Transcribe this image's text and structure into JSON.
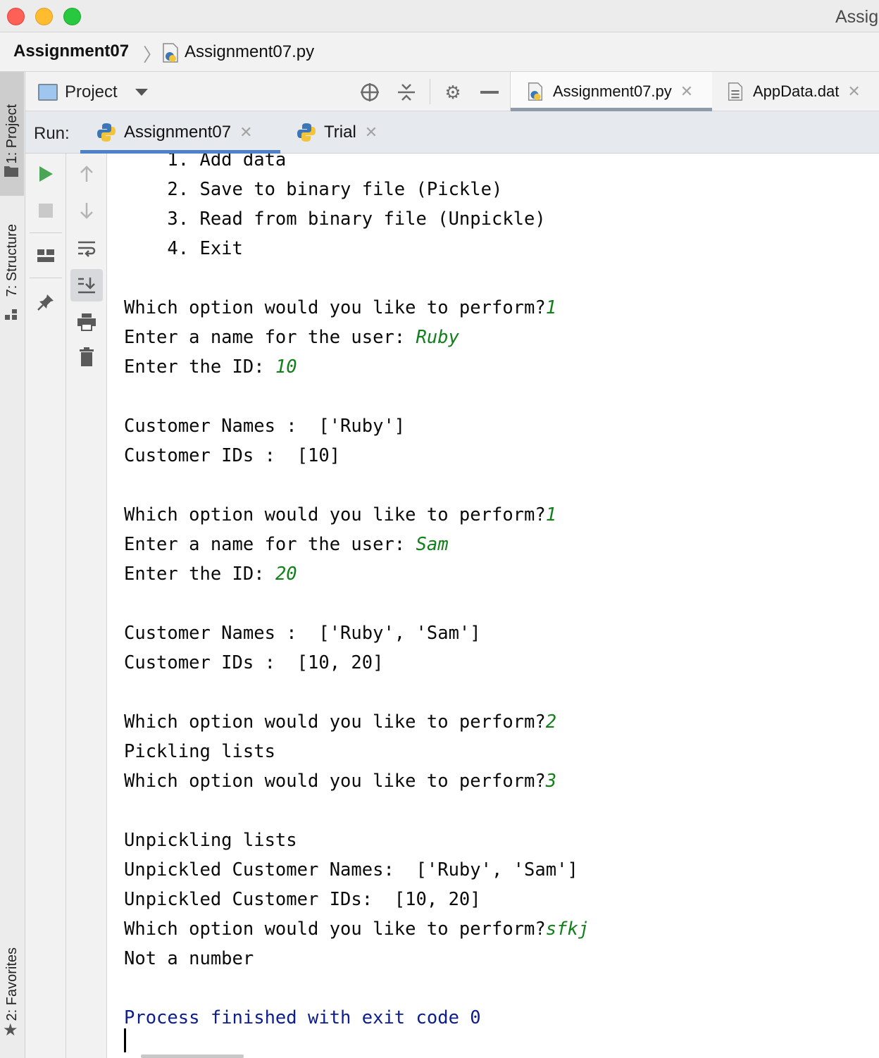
{
  "window": {
    "title": "Assig"
  },
  "breadcrumb": {
    "project": "Assignment07",
    "file": "Assignment07.py"
  },
  "sidebar": {
    "project_tab": "1: Project",
    "structure_tab": "7: Structure",
    "favorites_tab": "2: Favorites"
  },
  "project_panel": {
    "label": "Project"
  },
  "editor_tabs": [
    {
      "label": "Assignment07.py",
      "active": true
    },
    {
      "label": "AppData.dat",
      "active": false
    }
  ],
  "run": {
    "label": "Run:",
    "tabs": [
      {
        "label": "Assignment07",
        "active": true
      },
      {
        "label": "Trial",
        "active": false
      }
    ]
  },
  "console": {
    "lines": [
      {
        "text": "    1. Add data",
        "input": ""
      },
      {
        "text": "    2. Save to binary file (Pickle)",
        "input": ""
      },
      {
        "text": "    3. Read from binary file (Unpickle)",
        "input": ""
      },
      {
        "text": "    4. Exit",
        "input": ""
      },
      {
        "text": "",
        "input": ""
      },
      {
        "text": "Which option would you like to perform?",
        "input": "1"
      },
      {
        "text": "Enter a name for the user: ",
        "input": "Ruby"
      },
      {
        "text": "Enter the ID: ",
        "input": "10"
      },
      {
        "text": "",
        "input": ""
      },
      {
        "text": "Customer Names :  ['Ruby']",
        "input": ""
      },
      {
        "text": "Customer IDs :  [10]",
        "input": ""
      },
      {
        "text": "",
        "input": ""
      },
      {
        "text": "Which option would you like to perform?",
        "input": "1"
      },
      {
        "text": "Enter a name for the user: ",
        "input": "Sam"
      },
      {
        "text": "Enter the ID: ",
        "input": "20"
      },
      {
        "text": "",
        "input": ""
      },
      {
        "text": "Customer Names :  ['Ruby', 'Sam']",
        "input": ""
      },
      {
        "text": "Customer IDs :  [10, 20]",
        "input": ""
      },
      {
        "text": "",
        "input": ""
      },
      {
        "text": "Which option would you like to perform?",
        "input": "2"
      },
      {
        "text": "Pickling lists",
        "input": ""
      },
      {
        "text": "Which option would you like to perform?",
        "input": "3"
      },
      {
        "text": "",
        "input": ""
      },
      {
        "text": "Unpickling lists",
        "input": ""
      },
      {
        "text": "Unpickled Customer Names:  ['Ruby', 'Sam']",
        "input": ""
      },
      {
        "text": "Unpickled Customer IDs:  [10, 20]",
        "input": ""
      },
      {
        "text": "Which option would you like to perform?",
        "input": "sfkj"
      },
      {
        "text": "Not a number",
        "input": ""
      },
      {
        "text": "",
        "input": ""
      }
    ],
    "exit_message": "Process finished with exit code 0"
  },
  "colors": {
    "input_text": "#12801a",
    "exit_text": "#0c1d8c",
    "run_tab_underline": "#4e81c7"
  },
  "icons": {
    "run": "play-icon",
    "stop": "stop-icon",
    "layout": "layout-icon",
    "pin": "pin-icon",
    "up": "arrow-up-icon",
    "down": "arrow-down-icon",
    "wrap": "soft-wrap-icon",
    "scroll_end": "scroll-to-end-icon",
    "print": "print-icon",
    "trash": "trash-icon"
  }
}
